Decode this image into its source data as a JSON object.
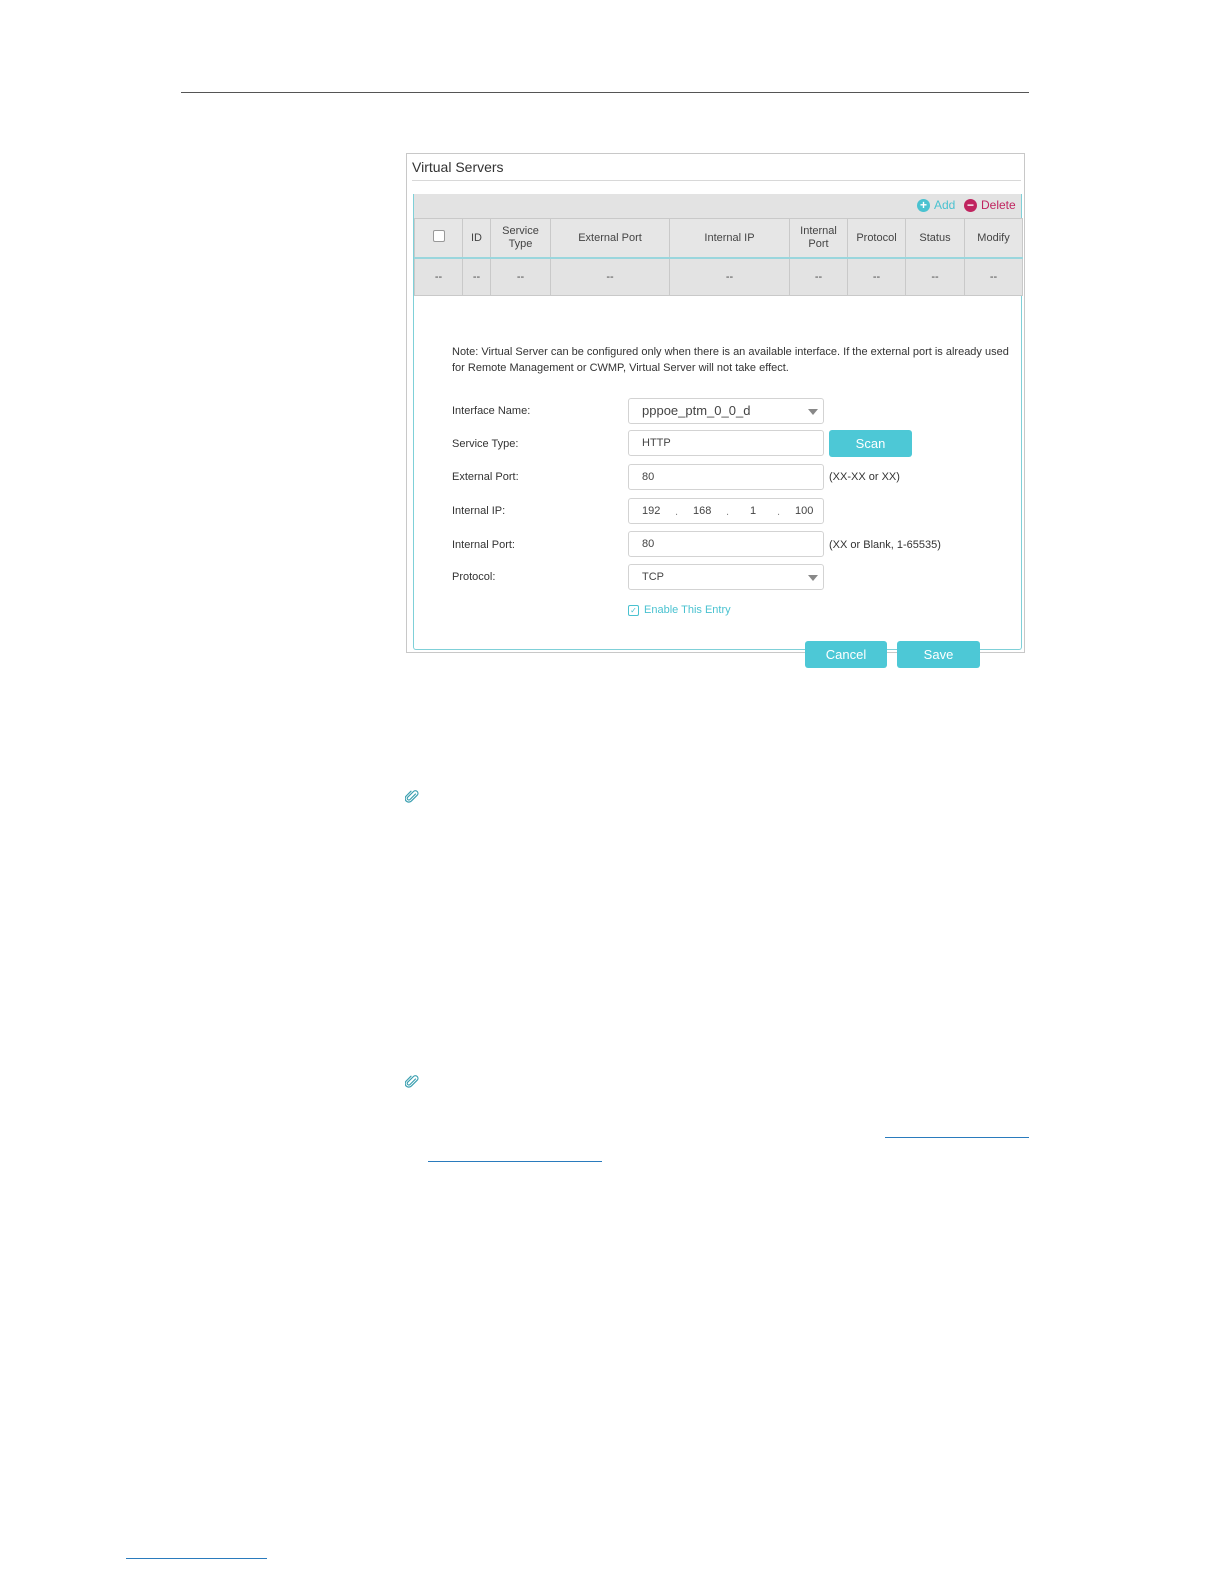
{
  "panel": {
    "title": "Virtual Servers",
    "toolbar": {
      "add_label": "Add",
      "delete_label": "Delete"
    },
    "table": {
      "columns": [
        "ID",
        "Service Type",
        "External Port",
        "Internal IP",
        "Internal Port",
        "Protocol",
        "Status",
        "Modify"
      ],
      "row": [
        "--",
        "--",
        "--",
        "--",
        "--",
        "--",
        "--",
        "--",
        "--"
      ]
    },
    "note": "Note: Virtual Server can be configured only when there is an available interface. If the external port is already used for Remote Management or CWMP, Virtual Server will not take effect.",
    "form": {
      "interface_label": "Interface Name:",
      "interface_value": "pppoe_ptm_0_0_d",
      "service_label": "Service Type:",
      "service_value": "HTTP",
      "scan_label": "Scan",
      "external_port_label": "External Port:",
      "external_port_value": "80",
      "external_port_hint": "(XX-XX or XX)",
      "internal_ip_label": "Internal IP:",
      "internal_ip_parts": [
        "192",
        "168",
        "1",
        "100"
      ],
      "internal_port_label": "Internal Port:",
      "internal_port_value": "80",
      "internal_port_hint": "(XX or Blank, 1-65535)",
      "protocol_label": "Protocol:",
      "protocol_value": "TCP",
      "enable_label": "Enable This Entry",
      "cancel_label": "Cancel",
      "save_label": "Save"
    }
  },
  "colors": {
    "accent": "#4dc8d6",
    "delete": "#c0245f"
  },
  "icons": [
    "add-icon",
    "delete-icon",
    "paperclip-icon"
  ]
}
